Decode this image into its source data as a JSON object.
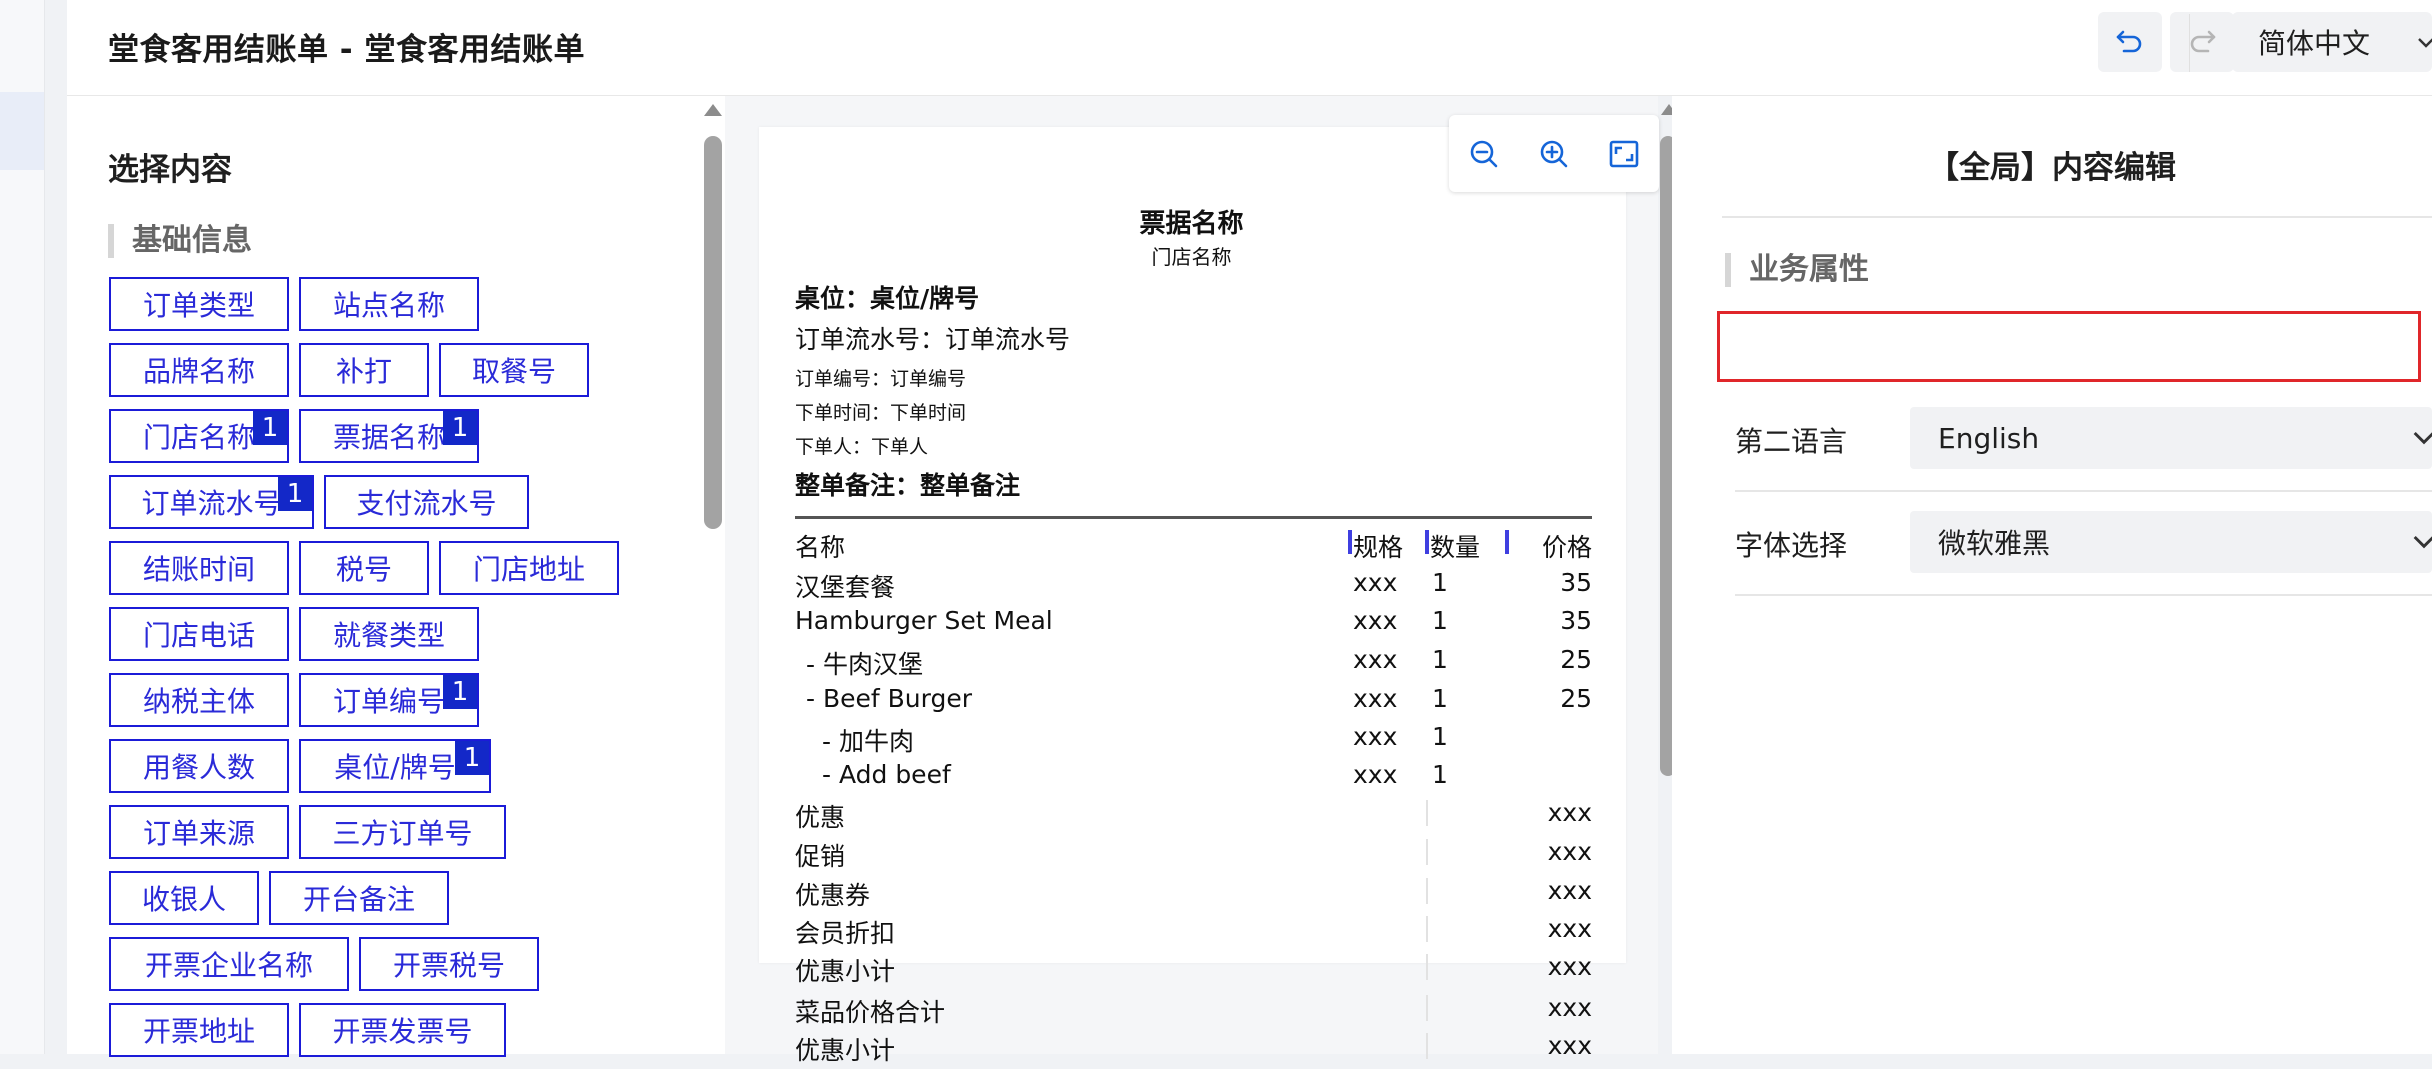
{
  "header": {
    "title": "堂食客用结账单 - 堂食客用结账单",
    "language": "简体中文"
  },
  "left_panel": {
    "title": "选择内容",
    "section": "基础信息",
    "rows": [
      [
        {
          "label": "订单类型"
        },
        {
          "label": "站点名称"
        }
      ],
      [
        {
          "label": "品牌名称"
        },
        {
          "label": "补打"
        },
        {
          "label": "取餐号"
        }
      ],
      [
        {
          "label": "门店名称",
          "badge": "1"
        },
        {
          "label": "票据名称",
          "badge": "1"
        }
      ],
      [
        {
          "label": "订单流水号",
          "badge": "1"
        },
        {
          "label": "支付流水号"
        }
      ],
      [
        {
          "label": "结账时间"
        },
        {
          "label": "税号"
        },
        {
          "label": "门店地址"
        }
      ],
      [
        {
          "label": "门店电话"
        },
        {
          "label": "就餐类型"
        }
      ],
      [
        {
          "label": "纳税主体"
        },
        {
          "label": "订单编号",
          "badge": "1"
        }
      ],
      [
        {
          "label": "用餐人数"
        },
        {
          "label": "桌位/牌号",
          "badge": "1"
        }
      ],
      [
        {
          "label": "订单来源"
        },
        {
          "label": "三方订单号"
        }
      ],
      [
        {
          "label": "收银人"
        },
        {
          "label": "开台备注"
        }
      ],
      [
        {
          "label": "开票企业名称"
        },
        {
          "label": "开票税号"
        }
      ],
      [
        {
          "label": "开票地址"
        },
        {
          "label": "开票发票号"
        }
      ]
    ]
  },
  "preview": {
    "receipt_title": "票据名称",
    "store_name": "门店名称",
    "table_no": "桌位：桌位/牌号",
    "serial_no": "订单流水号：订单流水号",
    "order_no": "订单编号：订单编号",
    "order_time": "下单时间：下单时间",
    "orderer": "下单人：下单人",
    "remark": "整单备注：整单备注",
    "columns": {
      "name": "名称",
      "spec": "规格",
      "qty": "数量",
      "price": "价格"
    },
    "items": [
      {
        "name": "汉堡套餐",
        "spec": "xxx",
        "qty": "1",
        "price": "35"
      },
      {
        "name": "Hamburger Set Meal",
        "spec": "xxx",
        "qty": "1",
        "price": "35"
      },
      {
        "name": " - 牛肉汉堡",
        "spec": "xxx",
        "qty": "1",
        "price": "25"
      },
      {
        "name": " - Beef Burger",
        "spec": "xxx",
        "qty": "1",
        "price": "25"
      },
      {
        "name": "   - 加牛肉",
        "spec": "xxx",
        "qty": "1",
        "price": ""
      },
      {
        "name": "   - Add beef",
        "spec": "xxx",
        "qty": "1",
        "price": ""
      }
    ],
    "summary": [
      {
        "label": "优惠",
        "value": "xxx"
      },
      {
        "label": "促销",
        "value": "xxx"
      },
      {
        "label": "优惠券",
        "value": "xxx"
      },
      {
        "label": "会员折扣",
        "value": "xxx"
      },
      {
        "label": "优惠小计",
        "value": "xxx"
      },
      {
        "label": "菜品价格合计",
        "value": "xxx"
      },
      {
        "label": "优惠小计",
        "value": "xxx"
      }
    ]
  },
  "right_panel": {
    "title": "【全局】内容编辑",
    "section": "业务属性",
    "fields": [
      {
        "label": "第二语言",
        "value": "English"
      },
      {
        "label": "字体选择",
        "value": "微软雅黑"
      }
    ]
  },
  "colors": {
    "accent": "#1b1bd8",
    "badge": "#1328c8",
    "highlight": "#e0262a"
  }
}
